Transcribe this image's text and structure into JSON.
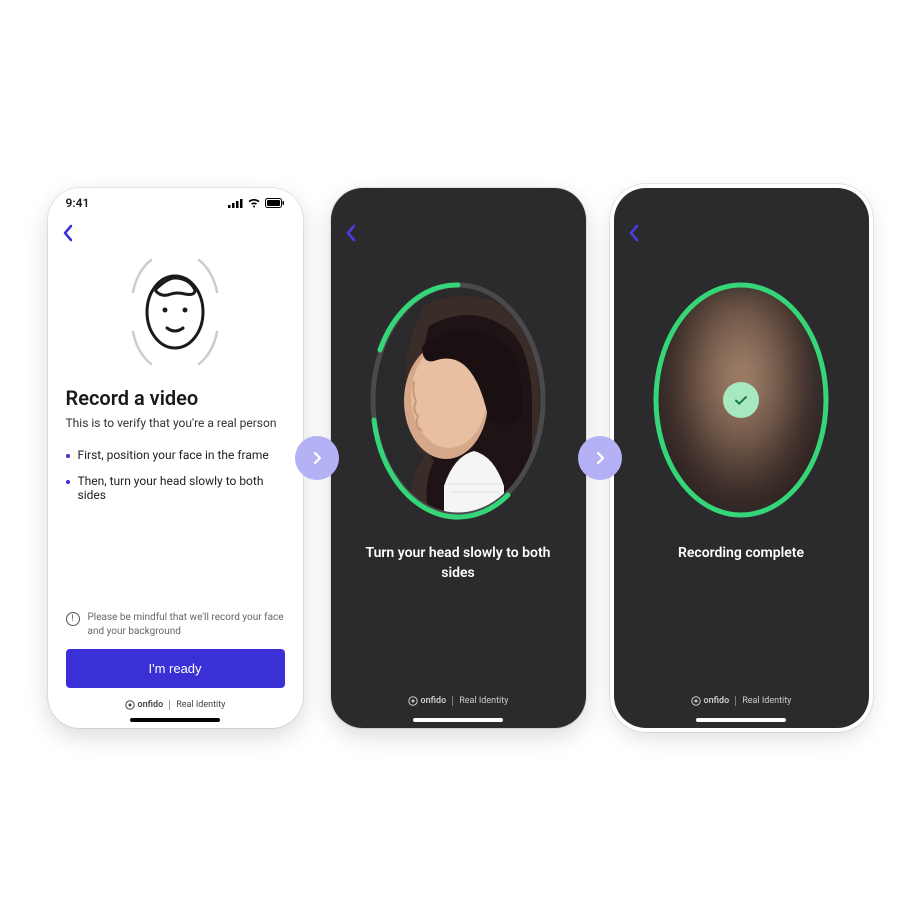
{
  "screens": {
    "intro": {
      "status_time": "9:41",
      "heading": "Record a video",
      "subheading": "This is to verify that you're a real person",
      "bullets": [
        "First, position your face in the frame",
        "Then, turn your head slowly to both sides"
      ],
      "notice": "Please be mindful that we'll record your face and your background",
      "primary_button": "I'm ready"
    },
    "capture": {
      "instruction": "Turn your head slowly to both sides"
    },
    "complete": {
      "instruction": "Recording complete"
    }
  },
  "brand": {
    "name": "onfido",
    "tagline": "Real Identity"
  },
  "colors": {
    "accent": "#3b2fd6",
    "progress": "#34d678",
    "arrow_bg": "#b5b1f5"
  }
}
